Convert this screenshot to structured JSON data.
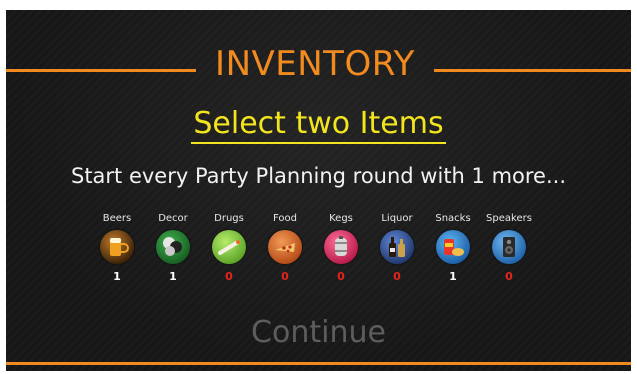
{
  "header": {
    "title": "INVENTORY"
  },
  "subtitle": "Select two Items",
  "description": "Start every Party Planning round with 1 more...",
  "items": [
    {
      "label": "Beers",
      "count": "1",
      "icon": "beer-mug-icon",
      "color": "#6b4218",
      "count_color": "#ffffff"
    },
    {
      "label": "Decor",
      "count": "1",
      "icon": "balloons-icon",
      "color": "#2c8a3a",
      "count_color": "#ffffff"
    },
    {
      "label": "Drugs",
      "count": "0",
      "icon": "joint-icon",
      "color": "#7fcf3a",
      "count_color": "#e8241c"
    },
    {
      "label": "Food",
      "count": "0",
      "icon": "pizza-icon",
      "color": "#e0722c",
      "count_color": "#e8241c"
    },
    {
      "label": "Kegs",
      "count": "0",
      "icon": "keg-icon",
      "color": "#e8336b",
      "count_color": "#e8241c"
    },
    {
      "label": "Liquor",
      "count": "0",
      "icon": "liquor-bottles-icon",
      "color": "#3a5ea8",
      "count_color": "#e8241c"
    },
    {
      "label": "Snacks",
      "count": "1",
      "icon": "snacks-icon",
      "color": "#2f8ad8",
      "count_color": "#ffffff"
    },
    {
      "label": "Speakers",
      "count": "0",
      "icon": "speaker-icon",
      "color": "#3b8fd6",
      "count_color": "#e8241c"
    }
  ],
  "continue_label": "Continue",
  "colors": {
    "accent": "#f08a1e",
    "subtitle": "#f3e51d",
    "zero_count": "#e8241c",
    "disabled": "#5d5d5d"
  }
}
